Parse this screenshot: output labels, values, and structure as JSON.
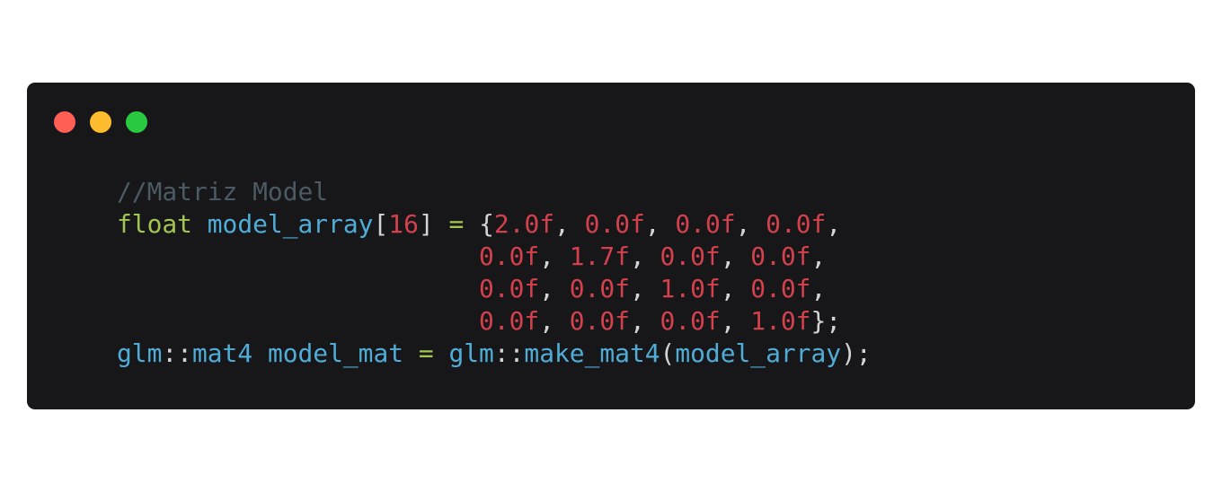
{
  "window": {
    "background": "#171719",
    "controls": [
      {
        "name": "close",
        "color": "#ff5f57"
      },
      {
        "name": "minimize",
        "color": "#febc2e"
      },
      {
        "name": "maximize",
        "color": "#28c840"
      }
    ]
  },
  "token_colors": {
    "comment": "#4b5a63",
    "keyword": "#a3c653",
    "identifier": "#4fadd8",
    "number": "#d4414d",
    "punct": "#d4d4d4",
    "operator": "#a3c653",
    "plain": "#d4d4d4"
  },
  "code": {
    "lines": [
      [
        {
          "t": "//Matriz Model",
          "k": "comment"
        }
      ],
      [
        {
          "t": "float",
          "k": "keyword"
        },
        {
          "t": " ",
          "k": "plain"
        },
        {
          "t": "model_array",
          "k": "identifier"
        },
        {
          "t": "[",
          "k": "punct"
        },
        {
          "t": "16",
          "k": "number"
        },
        {
          "t": "]",
          "k": "punct"
        },
        {
          "t": " ",
          "k": "plain"
        },
        {
          "t": "=",
          "k": "operator"
        },
        {
          "t": " ",
          "k": "plain"
        },
        {
          "t": "{",
          "k": "punct"
        },
        {
          "t": "2.0f",
          "k": "number"
        },
        {
          "t": ", ",
          "k": "punct"
        },
        {
          "t": "0.0f",
          "k": "number"
        },
        {
          "t": ", ",
          "k": "punct"
        },
        {
          "t": "0.0f",
          "k": "number"
        },
        {
          "t": ", ",
          "k": "punct"
        },
        {
          "t": "0.0f",
          "k": "number"
        },
        {
          "t": ",",
          "k": "punct"
        }
      ],
      [
        {
          "t": "                        ",
          "k": "plain"
        },
        {
          "t": "0.0f",
          "k": "number"
        },
        {
          "t": ", ",
          "k": "punct"
        },
        {
          "t": "1.7f",
          "k": "number"
        },
        {
          "t": ", ",
          "k": "punct"
        },
        {
          "t": "0.0f",
          "k": "number"
        },
        {
          "t": ", ",
          "k": "punct"
        },
        {
          "t": "0.0f",
          "k": "number"
        },
        {
          "t": ",",
          "k": "punct"
        }
      ],
      [
        {
          "t": "                        ",
          "k": "plain"
        },
        {
          "t": "0.0f",
          "k": "number"
        },
        {
          "t": ", ",
          "k": "punct"
        },
        {
          "t": "0.0f",
          "k": "number"
        },
        {
          "t": ", ",
          "k": "punct"
        },
        {
          "t": "1.0f",
          "k": "number"
        },
        {
          "t": ", ",
          "k": "punct"
        },
        {
          "t": "0.0f",
          "k": "number"
        },
        {
          "t": ",",
          "k": "punct"
        }
      ],
      [
        {
          "t": "                        ",
          "k": "plain"
        },
        {
          "t": "0.0f",
          "k": "number"
        },
        {
          "t": ", ",
          "k": "punct"
        },
        {
          "t": "0.0f",
          "k": "number"
        },
        {
          "t": ", ",
          "k": "punct"
        },
        {
          "t": "0.0f",
          "k": "number"
        },
        {
          "t": ", ",
          "k": "punct"
        },
        {
          "t": "1.0f",
          "k": "number"
        },
        {
          "t": "};",
          "k": "punct"
        }
      ],
      [
        {
          "t": "glm",
          "k": "identifier"
        },
        {
          "t": "::",
          "k": "punct"
        },
        {
          "t": "mat4",
          "k": "identifier"
        },
        {
          "t": " ",
          "k": "plain"
        },
        {
          "t": "model_mat",
          "k": "identifier"
        },
        {
          "t": " ",
          "k": "plain"
        },
        {
          "t": "=",
          "k": "operator"
        },
        {
          "t": " ",
          "k": "plain"
        },
        {
          "t": "glm",
          "k": "identifier"
        },
        {
          "t": "::",
          "k": "punct"
        },
        {
          "t": "make_mat4",
          "k": "identifier"
        },
        {
          "t": "(",
          "k": "punct"
        },
        {
          "t": "model_array",
          "k": "identifier"
        },
        {
          "t": ");",
          "k": "punct"
        }
      ]
    ]
  }
}
